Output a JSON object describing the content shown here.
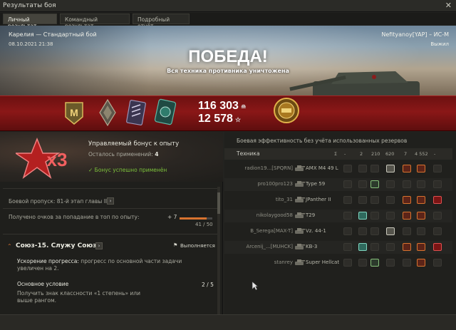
{
  "window": {
    "title": "Результаты боя",
    "close": "✕"
  },
  "tabs": [
    {
      "label": "Личный результат",
      "active": true
    },
    {
      "label": "Командный результат",
      "active": false
    },
    {
      "label": "Подробный отчёт",
      "active": false
    }
  ],
  "hero": {
    "map_mode": "Карелия — Стандартный бой",
    "datetime": "08.10.2021 21:38",
    "player_vehicle": "Nefityanoy[YAP] – ИС-М",
    "status": "Выжил",
    "result": "ПОБЕДА!",
    "result_sub": "Вся техника противника уничтожена"
  },
  "rewards": {
    "credits": "116 303",
    "xp": "12 578",
    "medals": [
      "mastery-badge-icon",
      "class-badge-icon",
      "stripe-badge-icon",
      "battle-hero-icon",
      "gold-order-icon"
    ],
    "mastery_letter": "M"
  },
  "bonus": {
    "multiplier": "x3",
    "title": "Управляемый бонус к опыту",
    "uses_label": "Осталось применений:",
    "uses_value": "4",
    "applied": "✓ Бонус успешно применён"
  },
  "battle_pass": {
    "label": "Боевой пропуск: 81-й этап главы II."
  },
  "top_xp": {
    "label": "Получено очков за попадание в топ по опыту:",
    "delta": "+ 7",
    "progress": "41 / 50",
    "fraction": 0.82
  },
  "mission": {
    "title": "Союз-15. Служу Союзу",
    "status": "Выполняется",
    "accel_label": "Ускорение прогресса:",
    "accel_text": "прогресс по основной части задачи увеличен на 2.",
    "cond_title": "Основное условие",
    "cond_value": "2 / 5",
    "cond_desc": "Получить знак классности «1 степень» или выше рангом."
  },
  "efficiency": {
    "title": "Боевая эффективность без учёта использованных резервов",
    "header_label": "Техника",
    "header_cols": [
      "Σ",
      "-",
      "2",
      "210",
      "620",
      "7",
      "4 552",
      "-"
    ],
    "rows": [
      {
        "player": "radion19...[SPQRN]",
        "tank": "AMX M4 49 L",
        "icons": [
          0,
          0,
          0,
          1,
          1,
          1,
          0
        ]
      },
      {
        "player": "pro100pro123",
        "tank": "Type 59",
        "icons": [
          0,
          0,
          1,
          0,
          0,
          0,
          0
        ]
      },
      {
        "player": "tito_31",
        "tank": "JPanther II",
        "icons": [
          0,
          0,
          0,
          0,
          1,
          1,
          1
        ]
      },
      {
        "player": "nikolaygood58",
        "tank": "T29",
        "icons": [
          0,
          1,
          0,
          0,
          1,
          1,
          0
        ]
      },
      {
        "player": "B_Serega[MAX-T]",
        "tank": "Vz. 44-1",
        "icons": [
          0,
          0,
          0,
          1,
          0,
          0,
          0
        ]
      },
      {
        "player": "Arcenij_...[MUHCK]",
        "tank": "KB-3",
        "icons": [
          0,
          1,
          0,
          0,
          1,
          1,
          1
        ]
      },
      {
        "player": "stanrey",
        "tank": "Super Hellcat",
        "icons": [
          0,
          0,
          1,
          0,
          0,
          1,
          0
        ]
      }
    ]
  },
  "colors": {
    "accent_red": "#8a1717",
    "ok_green": "#7cc13b",
    "progress_orange": "#d8732f"
  }
}
